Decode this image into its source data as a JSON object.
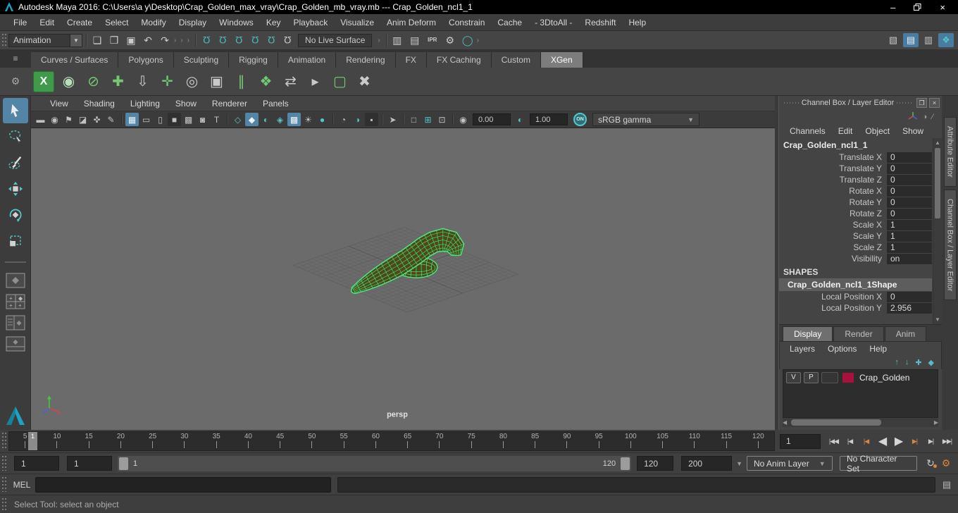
{
  "window": {
    "title": "Autodesk Maya 2016: C:\\Users\\a y\\Desktop\\Crap_Golden_max_vray\\Crap_Golden_mb_vray.mb   ---   Crap_Golden_ncl1_1",
    "controls": {
      "minimize": "–",
      "close": "×"
    }
  },
  "menu_bar": {
    "items": [
      "File",
      "Edit",
      "Create",
      "Select",
      "Modify",
      "Display",
      "Windows",
      "Key",
      "Playback",
      "Visualize",
      "Anim Deform",
      "Constrain",
      "Cache",
      "- 3DtoAll -",
      "Redshift",
      "Help"
    ]
  },
  "status_line": {
    "mode_selector": "Animation",
    "live_surface": "No Live Surface",
    "file_icons": [
      {
        "n": "new-scene-icon",
        "g": "❏"
      },
      {
        "n": "open-scene-icon",
        "g": "❒"
      },
      {
        "n": "save-scene-icon",
        "g": "▣"
      },
      {
        "n": "undo-icon",
        "g": "↶"
      },
      {
        "n": "redo-icon",
        "g": "↷"
      }
    ],
    "snap_icons": [
      {
        "n": "snap-to-grid-icon",
        "g": "Ω",
        "teal": true
      },
      {
        "n": "snap-to-curve-icon",
        "g": "Ω",
        "teal": true
      },
      {
        "n": "snap-to-point-icon",
        "g": "Ω",
        "teal": true
      },
      {
        "n": "snap-to-projected-center-icon",
        "g": "Ω",
        "teal": true
      },
      {
        "n": "snap-to-view-plane-icon",
        "g": "Ω",
        "teal": true
      },
      {
        "n": "make-live-icon",
        "g": "Ω"
      }
    ],
    "render_icons": [
      {
        "n": "render-view-icon",
        "g": "▥"
      },
      {
        "n": "render-current-frame-icon",
        "g": "▤"
      },
      {
        "n": "ipr-render-icon",
        "g": "IPR",
        "small": true
      },
      {
        "n": "render-settings-icon",
        "g": "⚙"
      },
      {
        "n": "render-setup-icon",
        "g": "◯",
        "teal": true
      }
    ],
    "right_icons": [
      {
        "n": "modeling-toolkit-toggle-icon",
        "g": "▧"
      },
      {
        "n": "channel-box-toggle-icon",
        "g": "▤",
        "blue": true
      },
      {
        "n": "tool-settings-toggle-icon",
        "g": "▥"
      },
      {
        "n": "attribute-editor-toggle-icon",
        "g": "❖",
        "teal": true
      }
    ]
  },
  "shelf": {
    "tab_menu_glyph": "≡",
    "gear_glyph": "⚙",
    "tabs": [
      "Curves / Surfaces",
      "Polygons",
      "Sculpting",
      "Rigging",
      "Animation",
      "Rendering",
      "FX",
      "FX Caching",
      "Custom",
      "XGen"
    ],
    "active_tab": "XGen",
    "icons": [
      {
        "n": "xgen-editor-icon",
        "g": "X",
        "tile": true
      },
      {
        "n": "xgen-update-preview-icon",
        "g": "◉",
        "c": "#b9e0b9"
      },
      {
        "n": "xgen-disable-preview-icon",
        "g": "⊘",
        "c": "#74c973"
      },
      {
        "n": "xgen-create-description-icon",
        "g": "✚",
        "c": "#74c973"
      },
      {
        "n": "xgen-export-patches-icon",
        "g": "⇩",
        "c": "#c9c9c9"
      },
      {
        "n": "xgen-add-guide-icon",
        "g": "✛",
        "c": "#74c973"
      },
      {
        "n": "xgen-guide-display-icon",
        "g": "◎",
        "c": "#c9c9c9"
      },
      {
        "n": "xgen-lock-guides-icon",
        "g": "▣",
        "c": "#c9c9c9"
      },
      {
        "n": "xgen-split-guide-icon",
        "g": "∥",
        "c": "#74c973"
      },
      {
        "n": "xgen-layers-icon",
        "g": "❖",
        "c": "#74c973"
      },
      {
        "n": "xgen-guide-flip-icon",
        "g": "⇄",
        "c": "#c9c9c9"
      },
      {
        "n": "xgen-select-guides-icon",
        "g": "▸",
        "c": "#c9c9c9"
      },
      {
        "n": "xgen-selection-region-icon",
        "g": "▢",
        "c": "#74c973"
      },
      {
        "n": "xgen-delete-guides-icon",
        "g": "✖",
        "c": "#c9c9c9"
      }
    ]
  },
  "panel": {
    "menus": [
      "View",
      "Shading",
      "Lighting",
      "Show",
      "Renderer",
      "Panels"
    ],
    "toolbar_icons": [
      {
        "n": "pt-select-camera-icon",
        "g": "▬"
      },
      {
        "n": "pt-camera-attributes-icon",
        "g": "◉"
      },
      {
        "n": "pt-bookmark-icon",
        "g": "⚑"
      },
      {
        "n": "pt-image-plane-icon",
        "g": "◪"
      },
      {
        "n": "pt-2d-pan-zoom-icon",
        "g": "✜"
      },
      {
        "n": "pt-grease-pencil-icon",
        "g": "✎"
      },
      {
        "sep": true
      },
      {
        "n": "pt-grid-icon",
        "g": "▦",
        "cls": "active"
      },
      {
        "n": "pt-film-gate-icon",
        "g": "▭"
      },
      {
        "n": "pt-resolution-gate-icon",
        "g": "▯"
      },
      {
        "n": "pt-gate-mask-icon",
        "g": "■",
        "cls": "dark"
      },
      {
        "n": "pt-field-chart-icon",
        "g": "▩"
      },
      {
        "n": "pt-safe-action-icon",
        "g": "◙"
      },
      {
        "n": "pt-safe-title-icon",
        "g": "T"
      },
      {
        "sep": true
      },
      {
        "n": "pt-wireframe-icon",
        "g": "◇",
        "cls": "teal"
      },
      {
        "n": "pt-shaded-icon",
        "g": "◆",
        "cls": "active"
      },
      {
        "n": "pt-flat-shade-icon",
        "g": "◐",
        "cls": "teal"
      },
      {
        "n": "pt-wireframe-on-shaded-icon",
        "g": "◈",
        "cls": "teal"
      },
      {
        "n": "pt-textured-icon",
        "g": "▩",
        "cls": "active"
      },
      {
        "n": "pt-use-lights-icon",
        "g": "☀"
      },
      {
        "n": "pt-shadows-icon",
        "g": "●",
        "cls": "teal"
      },
      {
        "sep": true
      },
      {
        "n": "pt-occlusion-icon",
        "g": "◔"
      },
      {
        "n": "pt-motion-blur-icon",
        "g": "◑",
        "cls": "teal"
      },
      {
        "n": "pt-multisample-icon",
        "g": "▪",
        "cls": "dark"
      },
      {
        "sep": true
      },
      {
        "n": "pt-isolate-select-icon",
        "g": "➤"
      },
      {
        "sep": true
      },
      {
        "n": "pt-xray-icon",
        "g": "□"
      },
      {
        "n": "pt-xray-joints-icon",
        "g": "⊞",
        "cls": "teal"
      },
      {
        "n": "pt-xray-active-icon",
        "g": "⊡"
      },
      {
        "sep": true
      },
      {
        "n": "pt-exposure-icon",
        "g": "◉"
      }
    ],
    "exposure": "0.00",
    "contrast_icon": "◐",
    "gamma": "1.00",
    "on_toggle": "ON",
    "view_transform": "sRGB gamma",
    "camera_label": "persp"
  },
  "channel_box": {
    "title": "Channel Box / Layer Editor",
    "menus": [
      "Channels",
      "Edit",
      "Object",
      "Show"
    ],
    "object_name": "Crap_Golden_ncl1_1",
    "channels": [
      {
        "label": "Translate X",
        "value": "0"
      },
      {
        "label": "Translate Y",
        "value": "0"
      },
      {
        "label": "Translate Z",
        "value": "0"
      },
      {
        "label": "Rotate X",
        "value": "0"
      },
      {
        "label": "Rotate Y",
        "value": "0"
      },
      {
        "label": "Rotate Z",
        "value": "0"
      },
      {
        "label": "Scale X",
        "value": "1"
      },
      {
        "label": "Scale Y",
        "value": "1"
      },
      {
        "label": "Scale Z",
        "value": "1"
      },
      {
        "label": "Visibility",
        "value": "on"
      }
    ],
    "shapes_header": "SHAPES",
    "shape_name": "Crap_Golden_ncl1_1Shape",
    "shape_channels": [
      {
        "label": "Local Position X",
        "value": "0"
      },
      {
        "label": "Local Position Y",
        "value": "2.956"
      }
    ]
  },
  "layer_editor": {
    "tabs": [
      "Display",
      "Render",
      "Anim"
    ],
    "active_tab": "Display",
    "menus": [
      "Layers",
      "Options",
      "Help"
    ],
    "icons": [
      {
        "n": "move-layer-up-icon",
        "g": "↑"
      },
      {
        "n": "move-layer-down-icon",
        "g": "↓"
      },
      {
        "n": "empty-layer-icon",
        "g": "✚"
      },
      {
        "n": "layer-from-selected-icon",
        "g": "◆"
      }
    ],
    "layers": [
      {
        "visibility": "V",
        "playback": "P",
        "name": "Crap_Golden",
        "color": "#a9103e"
      }
    ]
  },
  "timeline": {
    "ticks": [
      "5",
      "10",
      "15",
      "20",
      "25",
      "30",
      "35",
      "40",
      "45",
      "50",
      "55",
      "60",
      "65",
      "70",
      "75",
      "80",
      "85",
      "90",
      "95",
      "100",
      "105",
      "110",
      "115",
      "120"
    ],
    "current_frame": "1"
  },
  "playback": {
    "current_frame_field": "1",
    "buttons": [
      {
        "name": "go-to-start-button",
        "glyph": "|◀◀"
      },
      {
        "name": "step-back-frame-button",
        "glyph": "|◀"
      },
      {
        "name": "step-back-key-button",
        "glyph": "|◀",
        "key": true
      },
      {
        "name": "play-backwards-button",
        "glyph": "◀",
        "big": true
      },
      {
        "name": "play-forwards-button",
        "glyph": "▶",
        "big": true
      },
      {
        "name": "step-forward-key-button",
        "glyph": "▶|",
        "key": true
      },
      {
        "name": "step-forward-frame-button",
        "glyph": "▶|"
      },
      {
        "name": "go-to-end-button",
        "glyph": "▶▶|"
      }
    ]
  },
  "range_slider": {
    "animation_start": "1",
    "playback_start": "1",
    "slider_start_label": "1",
    "slider_end_label": "120",
    "playback_end": "120",
    "animation_end": "200",
    "anim_layer_selector": "No Anim Layer",
    "character_set_selector": "No Character Set"
  },
  "command_line": {
    "label": "MEL"
  },
  "help_line": {
    "text": "Select Tool: select an object"
  },
  "side_tabs": {
    "items": [
      "Attribute Editor",
      "Channel Box / Layer Editor"
    ]
  },
  "colors": {
    "accent_teal": "#4cbdbd",
    "highlight_blue": "#5285a6",
    "key_orange": "#d8863c",
    "selection_green": "#4ce886",
    "viewport_bg": "#6b6b6b",
    "layer_swatch": "#a9103e"
  }
}
